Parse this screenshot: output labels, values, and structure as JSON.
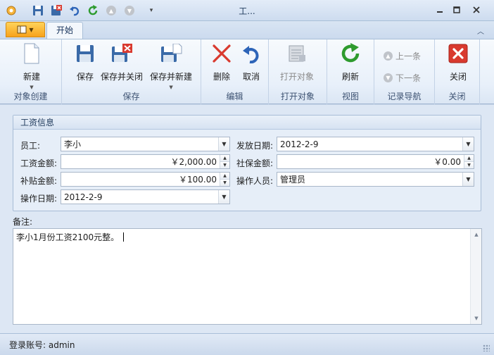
{
  "window": {
    "title": "工..."
  },
  "tabs": {
    "home": "开始"
  },
  "ribbon": {
    "groups": {
      "create": "对象创建",
      "save": "保存",
      "edit": "编辑",
      "open": "打开对象",
      "view": "视图",
      "nav": "记录导航",
      "close": "关闭"
    },
    "buttons": {
      "new": "新建",
      "save": "保存",
      "save_close": "保存并关闭",
      "save_new": "保存并新建",
      "delete": "删除",
      "cancel": "取消",
      "open_object": "打开对象",
      "refresh": "刷新",
      "prev": "上一条",
      "next": "下一条",
      "close": "关闭"
    }
  },
  "form": {
    "group_title": "工资信息",
    "employee_label": "员工:",
    "employee_value": "李小",
    "salary_label": "工资金额:",
    "salary_value": "￥2,000.00",
    "subsidy_label": "补贴金额:",
    "subsidy_value": "￥100.00",
    "opdate_label": "操作日期:",
    "opdate_value": "2012-2-9",
    "paydate_label": "发放日期:",
    "paydate_value": "2012-2-9",
    "social_label": "社保金额:",
    "social_value": "￥0.00",
    "operator_label": "操作人员:",
    "operator_value": "管理员"
  },
  "notes": {
    "label": "备注:",
    "text": "李小1月份工资2100元整。"
  },
  "status": {
    "account": "登录账号: admin"
  },
  "colors": {
    "accent": "#f7a21b",
    "ribbon_bg": "#e8f0fa",
    "delete_red": "#d93a2f",
    "refresh_green": "#2e9b2e"
  }
}
